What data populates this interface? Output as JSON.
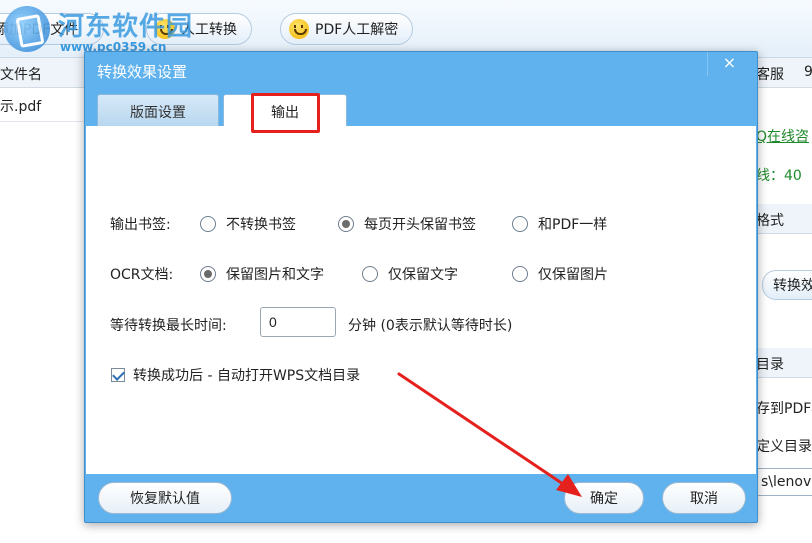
{
  "background": {
    "toolbar_buttons": [
      "添加PDF文件",
      "人工转换",
      "PDF人工解密"
    ],
    "watermark": {
      "title": "河东软件园",
      "url": "www.pc0359.cn"
    },
    "file_list": {
      "header": "文件名",
      "row": "示.pdf"
    },
    "right_panel": {
      "header": "客服",
      "header_extra": "9",
      "online_link": "Q在线咨",
      "hotline": "线：40",
      "format_label": "格式",
      "convert_button": "转换效",
      "dir_label": "目录",
      "save_to": "存到PDF相",
      "custom_dir": "定义目录",
      "path_value": "s\\lenovo"
    }
  },
  "dialog": {
    "title": "转换效果设置",
    "close_icon": "×",
    "tabs": [
      {
        "label": "版面设置",
        "active": false
      },
      {
        "label": "输出",
        "active": true
      }
    ],
    "bookmark": {
      "label": "输出书签:",
      "options": [
        {
          "label": "不转换书签",
          "checked": false
        },
        {
          "label": "每页开头保留书签",
          "checked": true
        },
        {
          "label": "和PDF一样",
          "checked": false
        }
      ]
    },
    "ocr": {
      "label": "OCR文档:",
      "options": [
        {
          "label": "保留图片和文字",
          "checked": true
        },
        {
          "label": "仅保留文字",
          "checked": false
        },
        {
          "label": "仅保留图片",
          "checked": false
        }
      ]
    },
    "wait": {
      "label": "等待转换最长时间:",
      "value": "0",
      "hint": "分钟  (0表示默认等待时长)"
    },
    "auto_open": {
      "label": "转换成功后 - 自动打开WPS文档目录",
      "checked": true
    },
    "buttons": {
      "restore": "恢复默认值",
      "ok": "确定",
      "cancel": "取消"
    }
  },
  "colors": {
    "dialog_blue": "#5fb2ee",
    "highlight_red": "#e5211e"
  }
}
